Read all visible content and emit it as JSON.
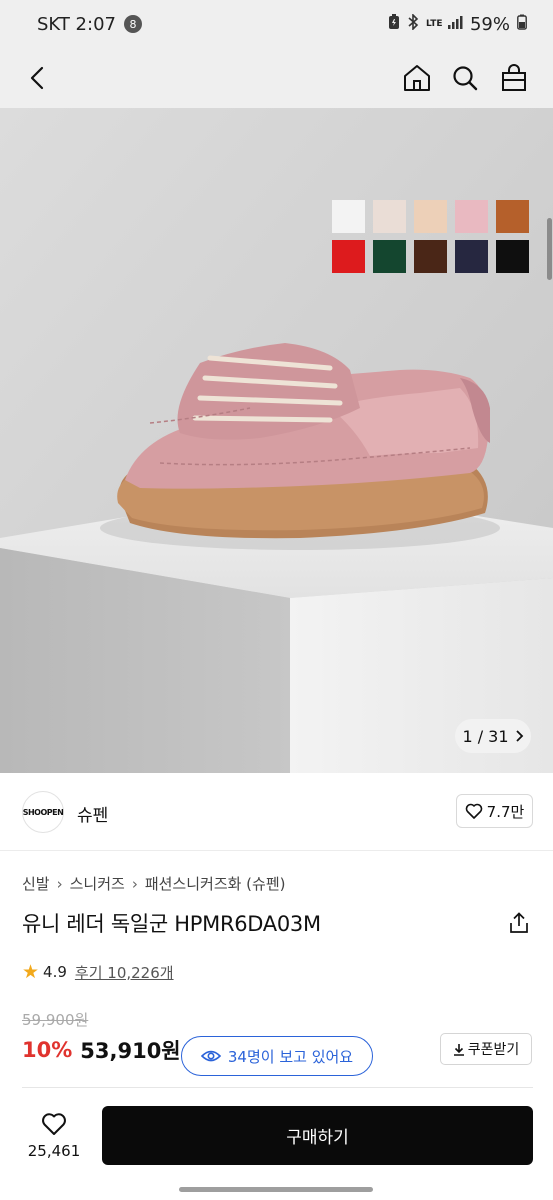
{
  "status_bar": {
    "carrier_time": "SKT 2:07",
    "notification_count": "8",
    "network": "LTE",
    "battery": "59%"
  },
  "product_image": {
    "counter": "1 / 31",
    "swatches": [
      "#f3f3f3",
      "#eaddd6",
      "#edd0b8",
      "#e9b9c1",
      "#b5602b",
      "#dd1b1d",
      "#14462f",
      "#4a2617",
      "#262740",
      "#0f0f0f"
    ]
  },
  "brand": {
    "logo_text": "SHOOPEN",
    "name": "슈펜",
    "like_count": "7.7만"
  },
  "breadcrumb": [
    "신발",
    "스니커즈",
    "패션스니커즈화 (슈펜)"
  ],
  "product": {
    "title": "유니 레더 독일군 HPMR6DA03M",
    "rating": "4.9",
    "review_text": "후기 10,226개",
    "original_price": "59,900원",
    "discount": "10%",
    "sale_price": "53,910원",
    "viewers": "34명이 보고 있어요",
    "coupon": "쿠폰받기"
  },
  "bottom_bar": {
    "wish_count": "25,461",
    "buy_label": "구매하기"
  },
  "colors": {
    "accent_blue": "#2b63d9",
    "discount_red": "#e0332e",
    "buy_button": "#0a0a0a"
  }
}
